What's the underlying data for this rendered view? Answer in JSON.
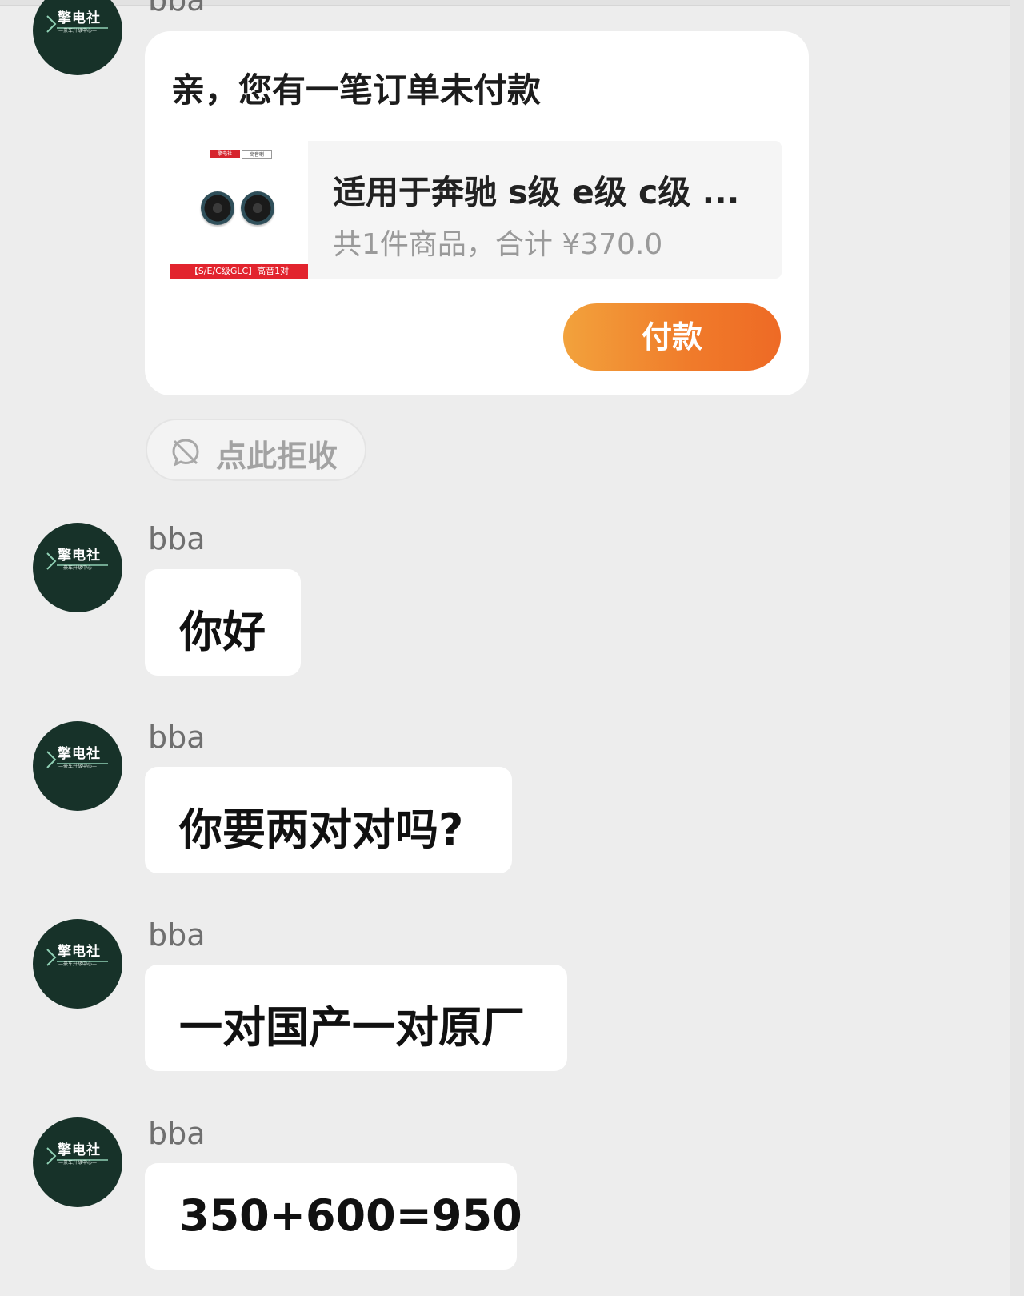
{
  "conversation": {
    "avatar_brand": "擎电社",
    "avatar_sub": "—豪车升级中心—",
    "order_card": {
      "sender": "bba",
      "title": "亲，您有一笔订单未付款",
      "thumb_tag_left": "擎电社",
      "thumb_tag_right": "高音喇",
      "thumb_bar": "【S/E/C级GLC】高音1对",
      "product_name": "适用于奔驰 s级 e级 c级 ...",
      "summary": "共1件商品，合计 ¥370.0",
      "pay_label": "付款"
    },
    "reject_label": "点此拒收",
    "messages": [
      {
        "sender": "bba",
        "text": "你好"
      },
      {
        "sender": "bba",
        "text": "你要两对对吗?"
      },
      {
        "sender": "bba",
        "text": "一对国产一对原厂"
      },
      {
        "sender": "bba",
        "text": "350+600=950"
      }
    ]
  },
  "icons": {
    "reject": "chat-off-icon",
    "logo": "chevron-logo-icon"
  },
  "colors": {
    "background": "#ededed",
    "avatar": "#173229",
    "pay_gradient_start": "#f2a23c",
    "pay_gradient_end": "#ee6a25"
  }
}
